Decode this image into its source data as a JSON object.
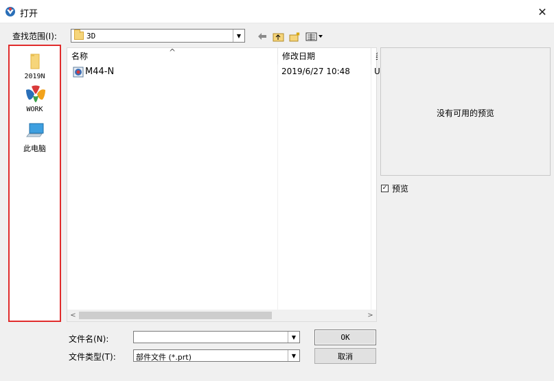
{
  "window": {
    "title": "打开",
    "close_glyph": "✕"
  },
  "lookin": {
    "label": "查找范围(I):",
    "value": "3D"
  },
  "places": {
    "items": [
      {
        "label": "2019N",
        "icon": "folder-icon"
      },
      {
        "label": "WORK",
        "icon": "work-app-icon"
      },
      {
        "label": "此电脑",
        "icon": "computer-icon"
      }
    ]
  },
  "filelist": {
    "columns": {
      "name": "名称",
      "date": "修改日期",
      "more": "类"
    },
    "rows": [
      {
        "name": "M44-N",
        "date": "2019/6/27 10:48",
        "more": "U"
      }
    ]
  },
  "preview": {
    "message": "没有可用的预览",
    "checkbox_label": "预览",
    "checked": true
  },
  "filename": {
    "label": "文件名(N):",
    "value": ""
  },
  "filetype": {
    "label": "文件类型(T):",
    "value": "部件文件 (*.prt)"
  },
  "buttons": {
    "ok": "OK",
    "cancel": "取消"
  },
  "colors": {
    "highlight_border": "#e02b2b",
    "folder": "#f6d57a"
  }
}
